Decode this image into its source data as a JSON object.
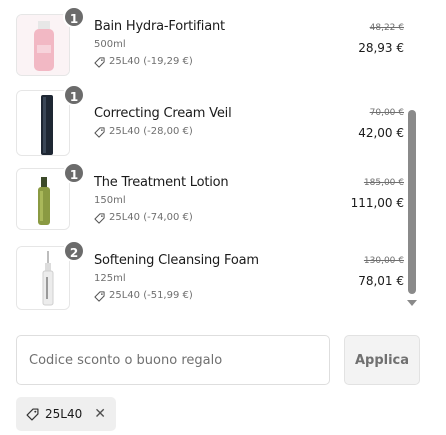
{
  "cart": {
    "items": [
      {
        "name": "Bain Hydra-Fortifiant",
        "variant": "500ml",
        "discount": "25L40 (-19,29 €)",
        "quantity": "1",
        "original_price": "48,22 €",
        "price": "28,93 €"
      },
      {
        "name": "Correcting Cream Veil",
        "variant": "",
        "discount": "25L40 (-28,00 €)",
        "quantity": "1",
        "original_price": "70,00 €",
        "price": "42,00 €"
      },
      {
        "name": "The Treatment Lotion",
        "variant": "150ml",
        "discount": "25L40 (-74,00 €)",
        "quantity": "1",
        "original_price": "185,00 €",
        "price": "111,00 €"
      },
      {
        "name": "Softening Cleansing Foam",
        "variant": "125ml",
        "discount": "25L40 (-51,99 €)",
        "quantity": "2",
        "original_price": "130,00 €",
        "price": "78,01 €"
      }
    ]
  },
  "discount_form": {
    "placeholder": "Codice sconto o buono regalo",
    "value": "",
    "apply_label": "Applica"
  },
  "applied_code": {
    "label": "25L40",
    "remove_symbol": "✕"
  },
  "colors": {
    "badge": "#6b6b6b",
    "scrollbar": "#8a8a8a",
    "tag_background": "#efefef"
  },
  "icons": {
    "discount": "tag-icon",
    "remove": "close-icon",
    "scroll": "chevron-down-icon"
  }
}
